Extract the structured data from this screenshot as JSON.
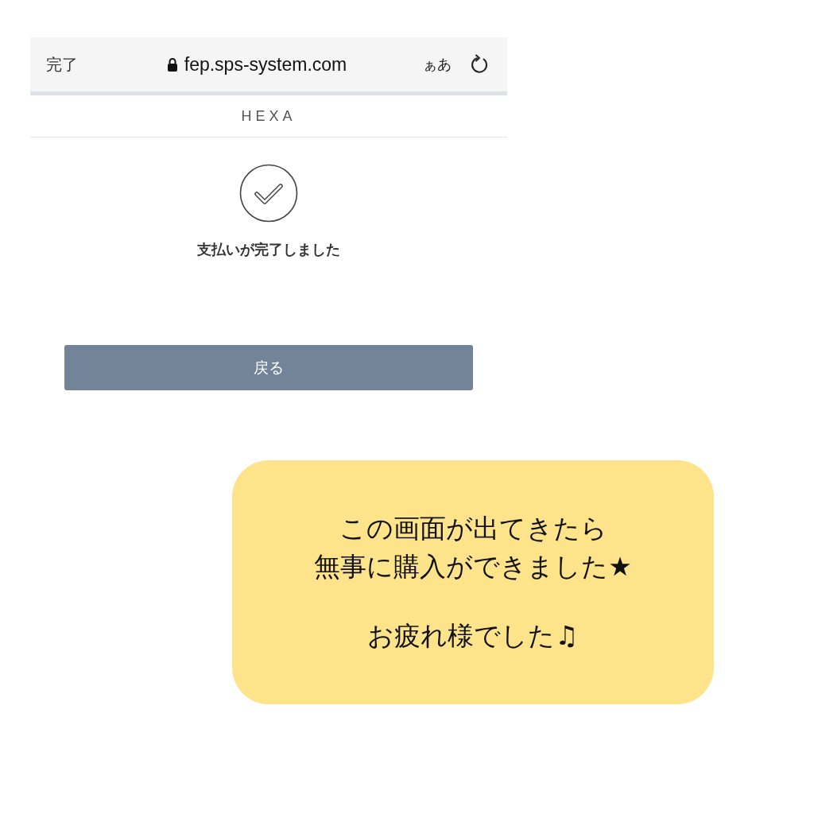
{
  "browser_bar": {
    "done": "完了",
    "url": "fep.sps-system.com",
    "text_size": "ぁあ"
  },
  "site": {
    "title": "HEXA"
  },
  "result": {
    "message": "支払いが完了しました",
    "button": "戻る"
  },
  "callout": {
    "paragraphs": [
      {
        "lines": [
          "この画面が出てきたら",
          "無事に購入ができました★"
        ]
      },
      {
        "lines": [
          "お疲れ様でした♫"
        ]
      }
    ]
  }
}
